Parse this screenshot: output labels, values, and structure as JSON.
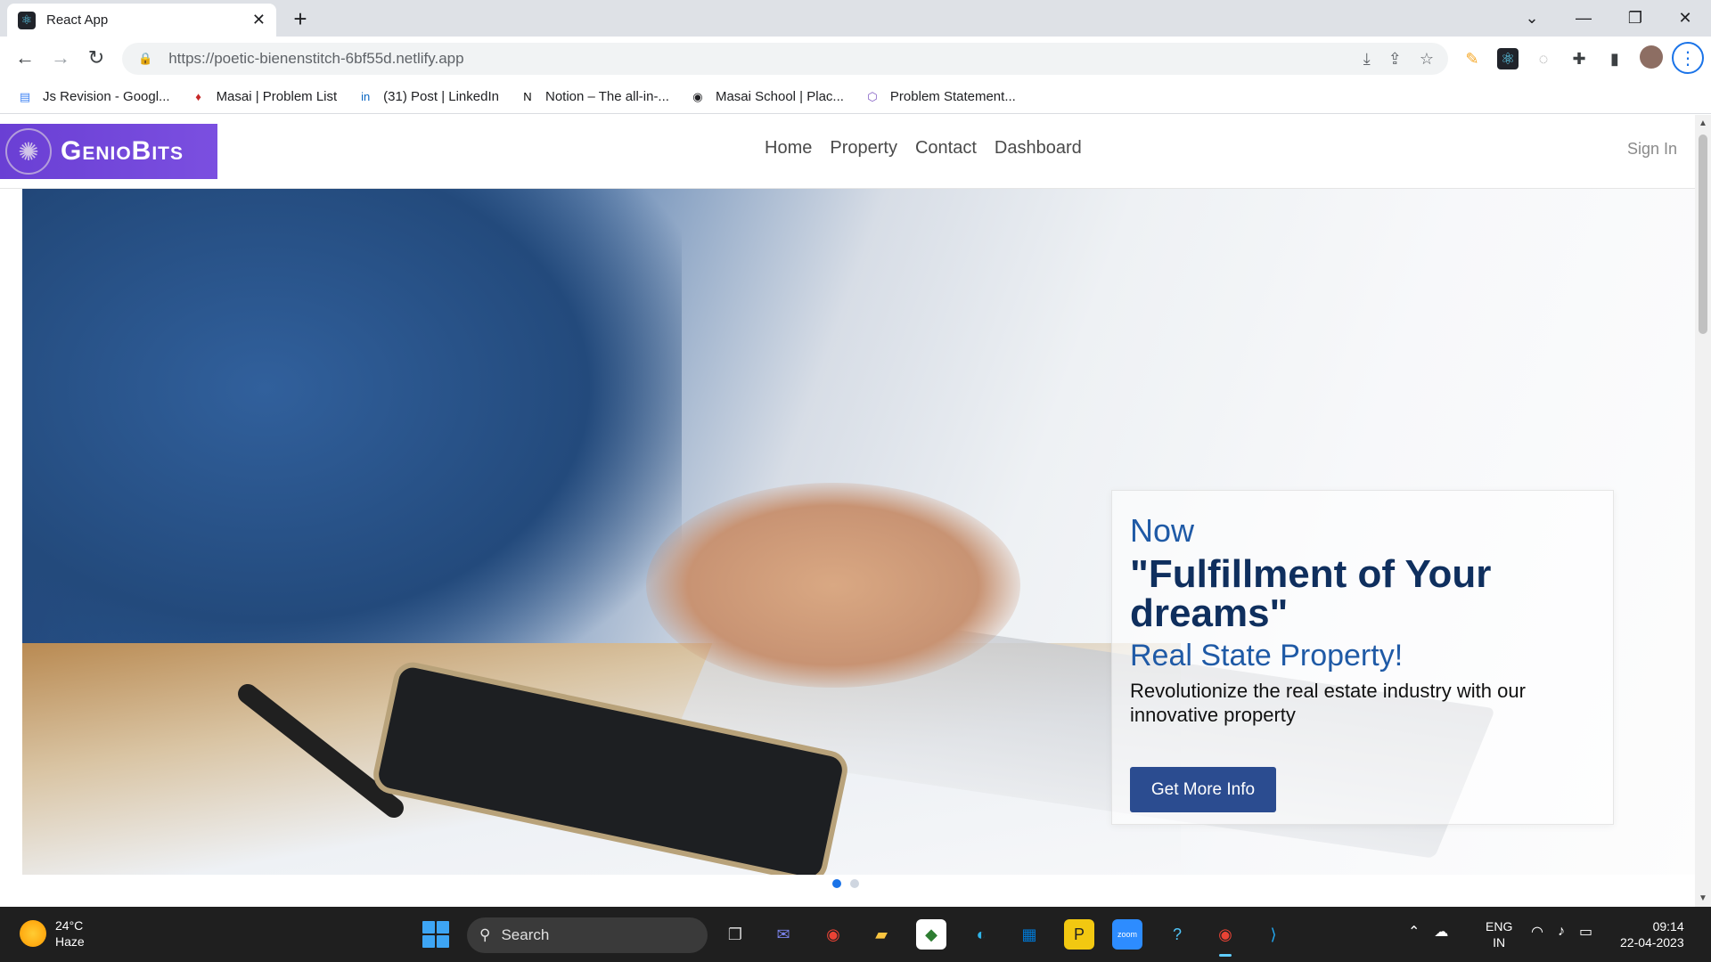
{
  "browser": {
    "tab_title": "React App",
    "url": "https://poetic-bienenstitch-6bf55d.netlify.app",
    "bookmarks": [
      {
        "label": "Js Revision - Googl...",
        "icon": "docs-icon",
        "color": "#4285f4"
      },
      {
        "label": "Masai | Problem List",
        "icon": "masai-icon",
        "color": "#c62828"
      },
      {
        "label": "(31) Post | LinkedIn",
        "icon": "linkedin-icon",
        "color": "#0a66c2"
      },
      {
        "label": "Notion – The all-in-...",
        "icon": "notion-icon",
        "color": "#000000"
      },
      {
        "label": "Masai School | Plac...",
        "icon": "globe-icon",
        "color": "#202124"
      },
      {
        "label": "Problem Statement...",
        "icon": "hexagon-icon",
        "color": "#7e57c2"
      }
    ]
  },
  "site": {
    "logo_text": "GenioBits",
    "nav": [
      "Home",
      "Property",
      "Contact",
      "Dashboard"
    ],
    "signin": "Sign In"
  },
  "hero": {
    "now": "Now",
    "headline": "\"Fulfillment of Your dreams\"",
    "subheadline": "Real State Property!",
    "description": "Revolutionize the real estate industry with our innovative property",
    "cta": "Get More Info",
    "slides": 2,
    "active_slide": 1
  },
  "taskbar": {
    "temperature": "24°C",
    "condition": "Haze",
    "search_label": "Search",
    "lang_top": "ENG",
    "lang_bottom": "IN",
    "time": "09:14",
    "date": "22-04-2023"
  },
  "colors": {
    "brand_purple": "#6a3fd4",
    "cta_blue": "#2b4c90",
    "headline_navy": "#0f2f5e",
    "accent_blue": "#1f5aa6"
  }
}
